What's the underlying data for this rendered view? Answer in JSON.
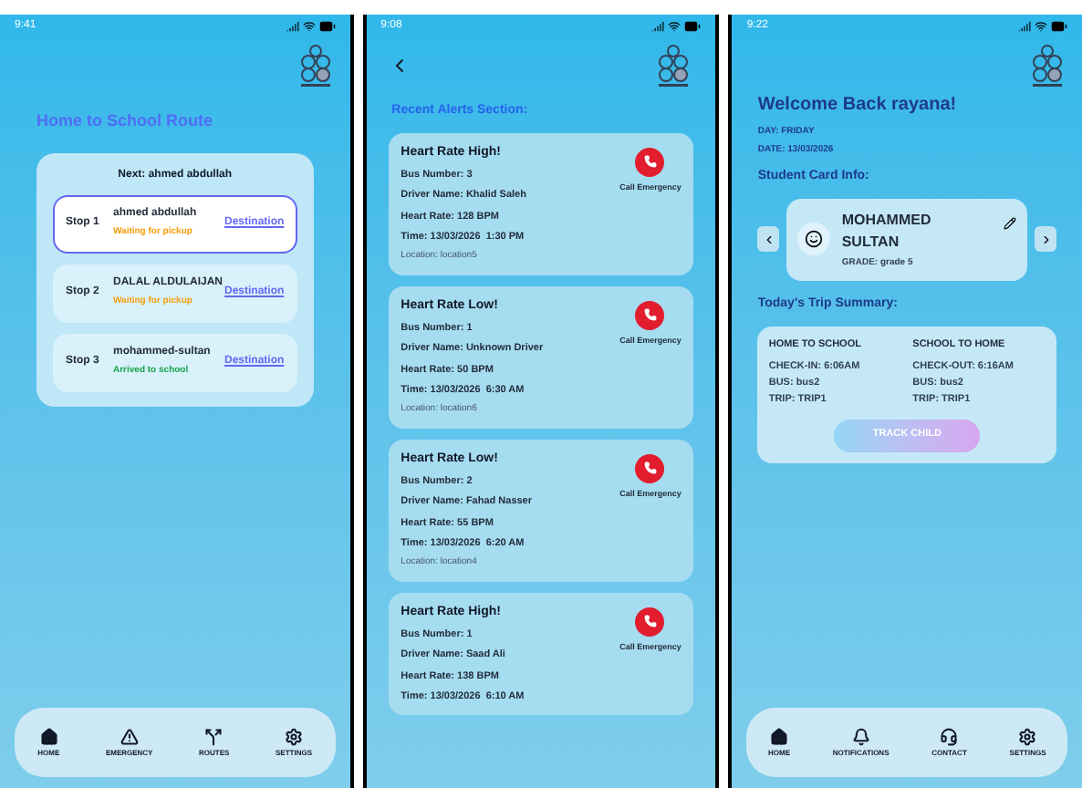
{
  "screens": [
    {
      "kind": "route",
      "status_time": "9:41",
      "title": "Home to School Route",
      "next": "Next: ahmed abdullah",
      "stops": [
        {
          "label": "Stop 1",
          "name": "ahmed abdullah",
          "status": "Waiting for pickup",
          "color": "#f59e0b",
          "link": "Destination",
          "selected": true
        },
        {
          "label": "Stop 2",
          "name": "DALAL ALDULAIJAN",
          "status": "Waiting for pickup",
          "color": "#f59e0b",
          "link": "Destination",
          "selected": false
        },
        {
          "label": "Stop 3",
          "name": "mohammed-sultan",
          "status": "Arrived to school",
          "color": "#16a34a",
          "link": "Destination",
          "selected": false
        }
      ],
      "nav": [
        {
          "label": "HOME"
        },
        {
          "label": "EMERGENCY"
        },
        {
          "label": "ROUTES"
        },
        {
          "label": "SETTINGS"
        }
      ]
    },
    {
      "kind": "alerts",
      "status_time": "9:08",
      "title": "Recent Alerts Section:",
      "alerts": [
        {
          "title": "Heart Rate High!",
          "lines": [
            "Bus Number: 3",
            "Driver Name: Khalid Saleh",
            "Heart Rate: 128 BPM",
            "Time: 13/03/2026  1:30 PM"
          ],
          "location": "Location: location5",
          "action": "Call Emergency"
        },
        {
          "title": "Heart Rate Low!",
          "lines": [
            "Bus Number: 1",
            "Driver Name: Unknown Driver",
            "Heart Rate: 50 BPM",
            "Time: 13/03/2026  6:30 AM"
          ],
          "location": "Location: location6",
          "action": "Call Emergency"
        },
        {
          "title": "Heart Rate Low!",
          "lines": [
            "Bus Number: 2",
            "Driver Name: Fahad Nasser",
            "Heart Rate: 55 BPM",
            "Time: 13/03/2026  6:20 AM"
          ],
          "location": "Location: location4",
          "action": "Call Emergency"
        },
        {
          "title": "Heart Rate High!",
          "lines": [
            "Bus Number: 1",
            "Driver Name: Saad Ali",
            "Heart Rate: 138 BPM",
            "Time: 13/03/2026  6:10 AM"
          ],
          "action": "Call Emergency"
        }
      ]
    },
    {
      "kind": "home",
      "status_time": "9:22",
      "title": "Welcome Back rayana!",
      "day": "DAY: FRIDAY",
      "date": "DATE: 13/03/2026",
      "card_heading": "Student Card Info:",
      "student": {
        "first": "MOHAMMED",
        "last": "SULTAN",
        "grade": "GRADE: grade 5"
      },
      "summary_heading": "Today's Trip Summary:",
      "trips": [
        {
          "heading": "HOME TO SCHOOL",
          "lines": [
            "CHECK-IN: 6:06AM",
            "BUS: bus2",
            "TRIP: TRIP1"
          ]
        },
        {
          "heading": "SCHOOL TO HOME",
          "lines": [
            "CHECK-OUT: 6:16AM",
            "BUS: bus2",
            "TRIP: TRIP1"
          ]
        }
      ],
      "button": "TRACK CHILD",
      "nav": [
        {
          "label": "HOME"
        },
        {
          "label": "NOTIFICATIONS"
        },
        {
          "label": "CONTACT"
        },
        {
          "label": "SETTINGS"
        }
      ]
    }
  ]
}
